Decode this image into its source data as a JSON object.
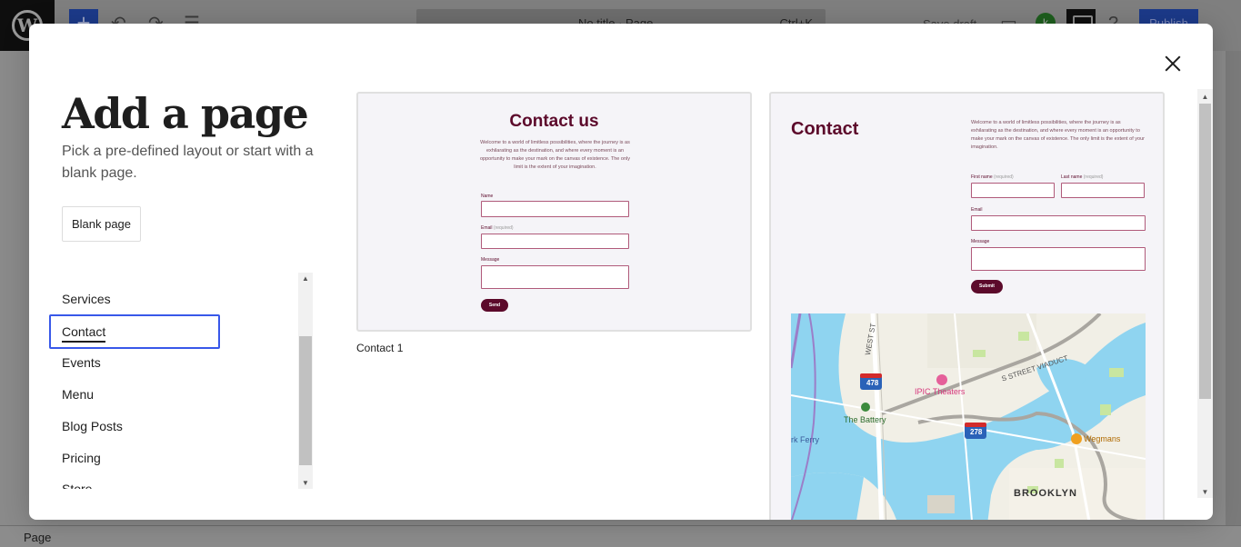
{
  "editor": {
    "document_title": "No title · Page",
    "command_shortcut": "Ctrl+K",
    "save_draft": "Save draft",
    "avatar_letter": "k",
    "publish": "Publish",
    "footer_breadcrumb": "Page"
  },
  "modal": {
    "title": "Add a page",
    "description": "Pick a pre-defined layout or start with a blank page.",
    "blank_page_button": "Blank page",
    "categories": [
      {
        "label": "Services",
        "active": false
      },
      {
        "label": "Contact",
        "active": true
      },
      {
        "label": "Events",
        "active": false
      },
      {
        "label": "Menu",
        "active": false
      },
      {
        "label": "Blog Posts",
        "active": false
      },
      {
        "label": "Pricing",
        "active": false
      },
      {
        "label": "Store",
        "active": false
      }
    ],
    "patterns": [
      {
        "caption": "Contact 1",
        "heading": "Contact us",
        "intro": "Welcome to a world of limitless possibilities, where the journey is as exhilarating as the destination, and where every moment is an opportunity to make your mark on the canvas of existence. The only limit is the extent of your imagination.",
        "fields": {
          "name": "Name",
          "email": "Email",
          "email_hint": "(required)",
          "message": "Message"
        },
        "button": "Send"
      },
      {
        "heading": "Contact",
        "intro": "Welcome to a world of limitless possibilities, where the journey is as exhilarating as the destination, and where every moment is an opportunity to make your mark on the canvas of existence. The only limit is the extent of your imagination.",
        "fields": {
          "first_name": "First name",
          "last_name": "Last name",
          "hint": "(required)",
          "email": "Email",
          "message": "Message"
        },
        "button": "Submit",
        "map_labels": {
          "west_st": "WEST ST",
          "viaduct": "S STREET VIADUCT",
          "ipic": "IPIC Theaters",
          "battery": "The Battery",
          "wegmans": "Wegmans",
          "brooklyn": "BROOKLYN",
          "ferry": "rk Ferry",
          "i478": "478",
          "i278": "278"
        }
      }
    ]
  },
  "colors": {
    "accent": "#3858e9",
    "brand": "#5c0a2b",
    "water": "#8fd4f0"
  }
}
